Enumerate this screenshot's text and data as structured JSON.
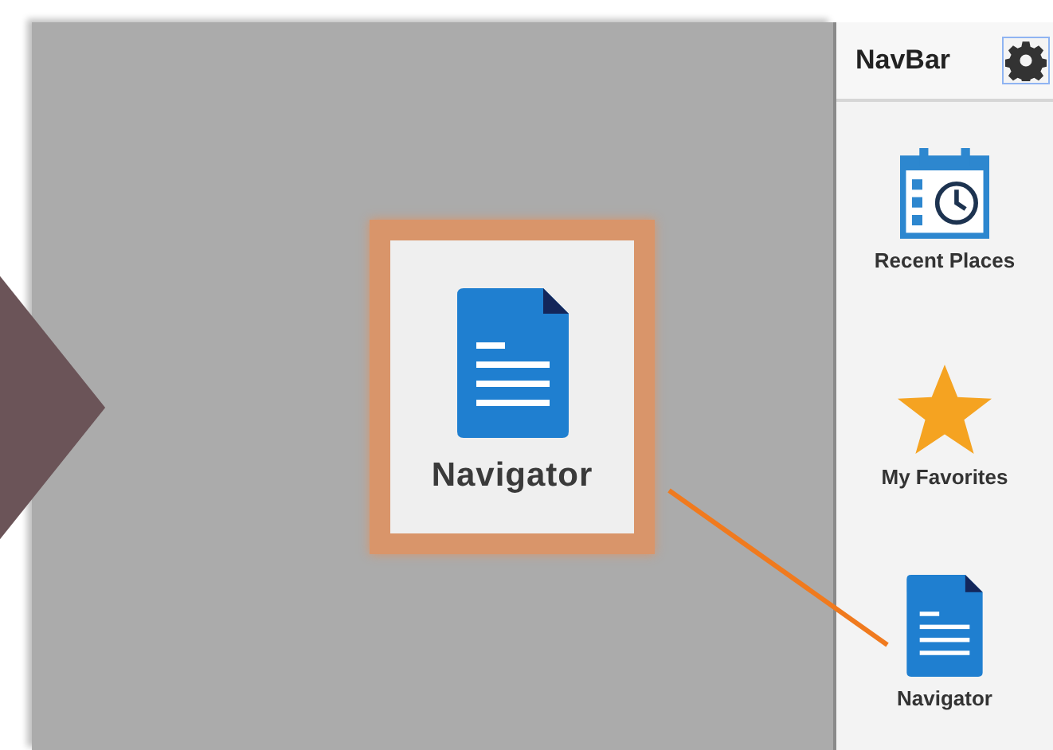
{
  "callout": {
    "label": "Navigator",
    "kind": "document"
  },
  "navbar": {
    "title": "NavBar",
    "items": [
      {
        "label": "Recent Places",
        "kind": "calendar"
      },
      {
        "label": "My Favorites",
        "kind": "star"
      },
      {
        "label": "Navigator",
        "kind": "document"
      }
    ]
  }
}
